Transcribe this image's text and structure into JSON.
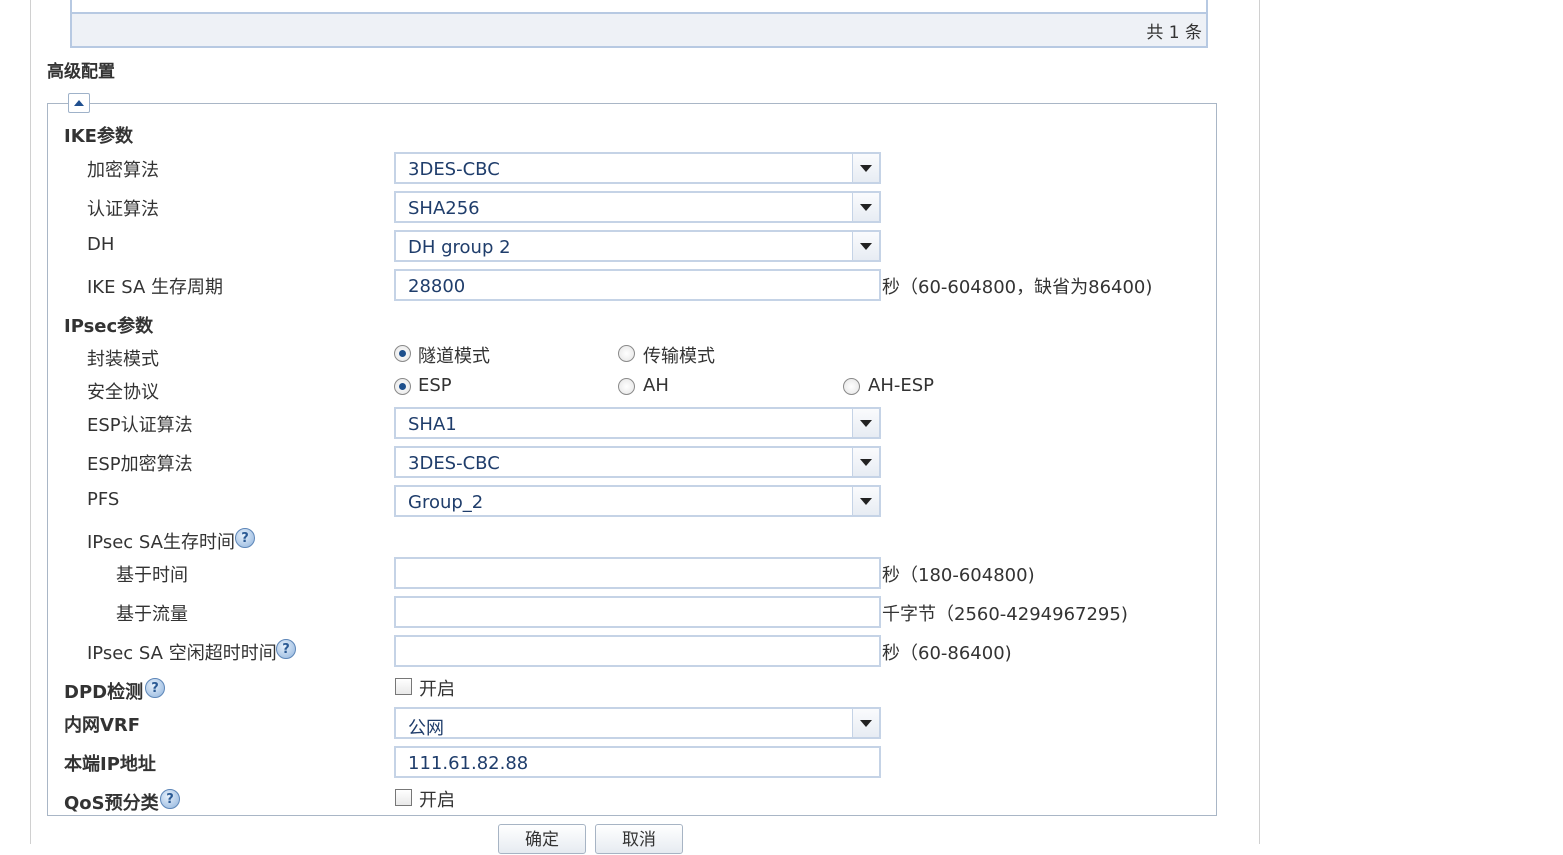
{
  "table": {
    "count_text": "共 1 条"
  },
  "section": {
    "title": "高级配置"
  },
  "ike": {
    "group_label": "IKE参数",
    "enc_label": "加密算法",
    "enc_value": "3DES-CBC",
    "auth_label": "认证算法",
    "auth_value": "SHA256",
    "dh_label": "DH",
    "dh_value": "DH group 2",
    "sa_label": "IKE SA 生存周期",
    "sa_value": "28800",
    "sa_unit": "秒（60-604800，缺省为86400)"
  },
  "ipsec": {
    "group_label": "IPsec参数",
    "encap_label": "封装模式",
    "encap_tunnel": "隧道模式",
    "encap_transport": "传输模式",
    "proto_label": "安全协议",
    "proto_esp": "ESP",
    "proto_ah": "AH",
    "proto_ahesp": "AH-ESP",
    "esp_auth_label": "ESP认证算法",
    "esp_auth_value": "SHA1",
    "esp_enc_label": "ESP加密算法",
    "esp_enc_value": "3DES-CBC",
    "pfs_label": "PFS",
    "pfs_value": "Group_2",
    "sa_life_label": "IPsec SA生存时间",
    "time_label": "基于时间",
    "time_value": "",
    "time_unit": "秒（180-604800)",
    "traffic_label": "基于流量",
    "traffic_value": "",
    "traffic_unit": "千字节（2560-4294967295)",
    "idle_label": "IPsec SA 空闲超时时间",
    "idle_value": "",
    "idle_unit": "秒（60-86400)"
  },
  "dpd": {
    "label": "DPD检测",
    "checkbox_label": "开启",
    "checked": false
  },
  "vrf": {
    "label": "内网VRF",
    "value": "公网"
  },
  "local_ip": {
    "label": "本端IP地址",
    "value": "111.61.82.88"
  },
  "qos": {
    "label": "QoS预分类",
    "checkbox_label": "开启",
    "checked": false
  },
  "buttons": {
    "ok": "确定",
    "cancel": "取消"
  },
  "help_glyph": "?"
}
